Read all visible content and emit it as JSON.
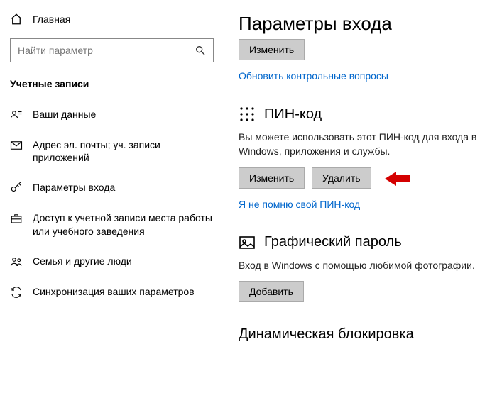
{
  "sidebar": {
    "home": "Главная",
    "search_placeholder": "Найти параметр",
    "section": "Учетные записи",
    "items": [
      {
        "label": "Ваши данные"
      },
      {
        "label": "Адрес эл. почты; уч. записи приложений"
      },
      {
        "label": "Параметры входа"
      },
      {
        "label": "Доступ к учетной записи места работы или учебного заведения"
      },
      {
        "label": "Семья и другие люди"
      },
      {
        "label": "Синхронизация ваших параметров"
      }
    ]
  },
  "main": {
    "title": "Параметры входа",
    "top_change": "Изменить",
    "update_questions": "Обновить контрольные вопросы",
    "pin": {
      "heading": "ПИН-код",
      "desc": "Вы можете использовать этот ПИН-код для входа в Windows, приложения и службы.",
      "change": "Изменить",
      "remove": "Удалить",
      "forgot": "Я не помню свой ПИН-код"
    },
    "picture": {
      "heading": "Графический пароль",
      "desc": "Вход в Windows с помощью любимой фотографии.",
      "add": "Добавить"
    },
    "dynamic": "Динамическая блокировка"
  }
}
